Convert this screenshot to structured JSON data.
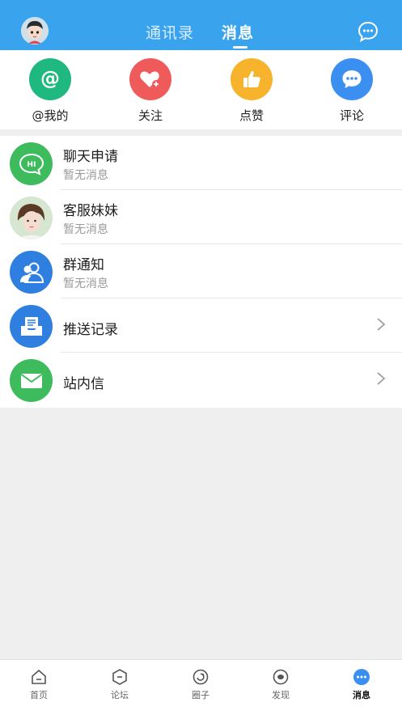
{
  "header": {
    "tabs": [
      {
        "label": "通讯录"
      },
      {
        "label": "消息"
      }
    ]
  },
  "quick_actions": [
    {
      "label": "@我的",
      "icon": "at-icon",
      "color": "#1fb880"
    },
    {
      "label": "关注",
      "icon": "heart-plus-icon",
      "color": "#ef5a5a"
    },
    {
      "label": "点赞",
      "icon": "thumbs-up-icon",
      "color": "#f6b32b"
    },
    {
      "label": "评论",
      "icon": "comment-icon",
      "color": "#3b8ff0"
    }
  ],
  "messages": [
    {
      "title": "聊天申请",
      "subtitle": "暂无消息",
      "icon": "hi-chat-icon",
      "color": "#3dbb5d"
    },
    {
      "title": "客服妹妹",
      "subtitle": "暂无消息",
      "icon": "support-avatar"
    },
    {
      "title": "群通知",
      "subtitle": "暂无消息",
      "icon": "group-icon",
      "color": "#2f7fe0"
    },
    {
      "title": "推送记录",
      "icon": "push-inbox-icon",
      "color": "#2f7fe0"
    },
    {
      "title": "站内信",
      "icon": "mail-icon",
      "color": "#3dbb5d"
    }
  ],
  "bottom_nav": [
    {
      "label": "首页",
      "icon": "home-icon"
    },
    {
      "label": "论坛",
      "icon": "forum-icon"
    },
    {
      "label": "圈子",
      "icon": "circle-icon"
    },
    {
      "label": "发现",
      "icon": "discover-icon"
    },
    {
      "label": "消息",
      "icon": "message-icon",
      "active": true
    }
  ]
}
